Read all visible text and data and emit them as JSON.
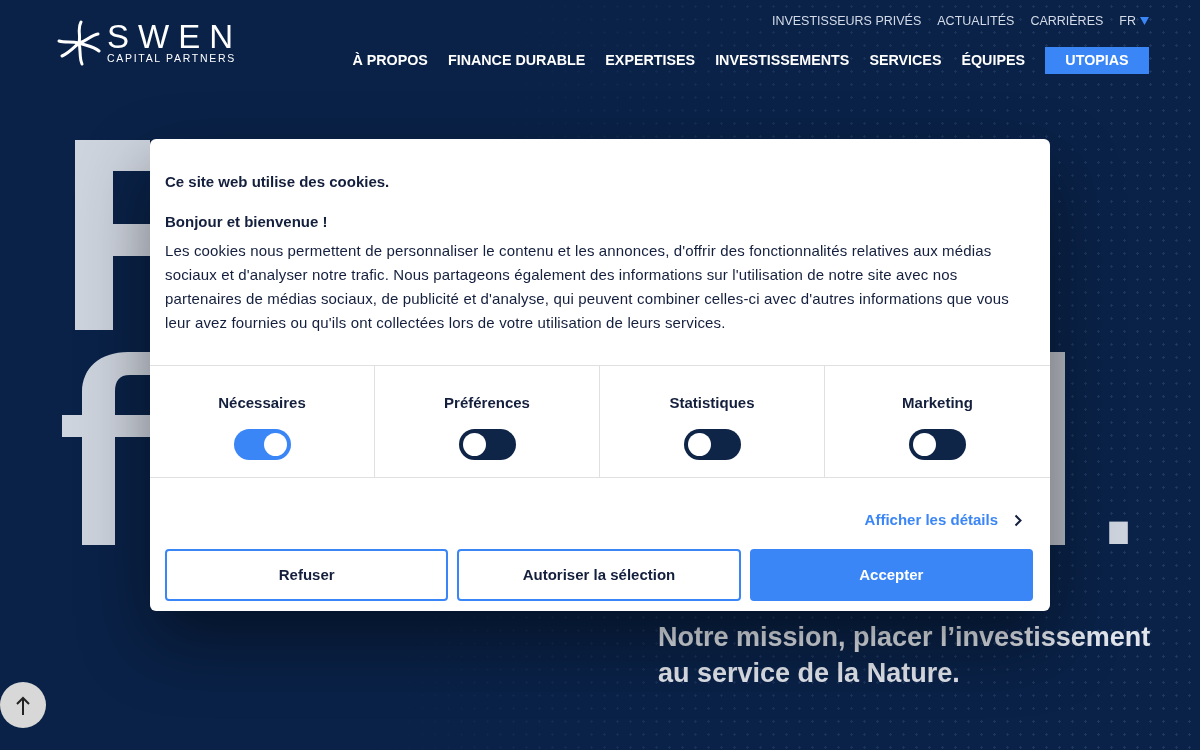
{
  "header": {
    "logo": {
      "name": "SWEN",
      "tagline": "CAPITAL PARTNERS"
    },
    "top_links": [
      {
        "label": "INVESTISSEURS PRIVÉS"
      },
      {
        "label": "ACTUALITÉS"
      },
      {
        "label": "CARRIÈRES"
      }
    ],
    "language": {
      "label": "FR"
    },
    "nav": [
      {
        "label": "À PROPOS",
        "kind": "link"
      },
      {
        "label": "FINANCE DURABLE",
        "kind": "link"
      },
      {
        "label": "EXPERTISES",
        "kind": "link"
      },
      {
        "label": "INVESTISSEMENTS",
        "kind": "link"
      },
      {
        "label": "SERVICES",
        "kind": "link"
      },
      {
        "label": "ÉQUIPES",
        "kind": "link"
      },
      {
        "label": "UTOPIAS",
        "kind": "button"
      }
    ]
  },
  "hero": {
    "end_mark": ".",
    "mission": [
      "Notre mission, placer l’investissement",
      "au service de la Nature."
    ]
  },
  "cookie_dialog": {
    "title": "Ce site web utilise des cookies.",
    "greeting": "Bonjour et bienvenue !",
    "text": "Les cookies nous permettent de personnaliser le contenu et les annonces, d'offrir des fonctionnalités relatives aux médias sociaux et d'analyser notre trafic. Nous partageons également des informations sur l'utilisation de notre site avec nos partenaires de médias sociaux, de publicité et d'analyse, qui peuvent combiner celles-ci avec d'autres informations que vous leur avez fournies ou qu'ils ont collectées lors de votre utilisation de leurs services.",
    "categories": [
      {
        "label": "Nécessaires",
        "on": true
      },
      {
        "label": "Préférences",
        "on": false
      },
      {
        "label": "Statistiques",
        "on": false
      },
      {
        "label": "Marketing",
        "on": false
      }
    ],
    "details_link": "Afficher les détails",
    "buttons": [
      {
        "label": "Refuser",
        "kind": "outline"
      },
      {
        "label": "Autoriser la sélection",
        "kind": "outline"
      },
      {
        "label": "Accepter",
        "kind": "primary"
      }
    ]
  }
}
